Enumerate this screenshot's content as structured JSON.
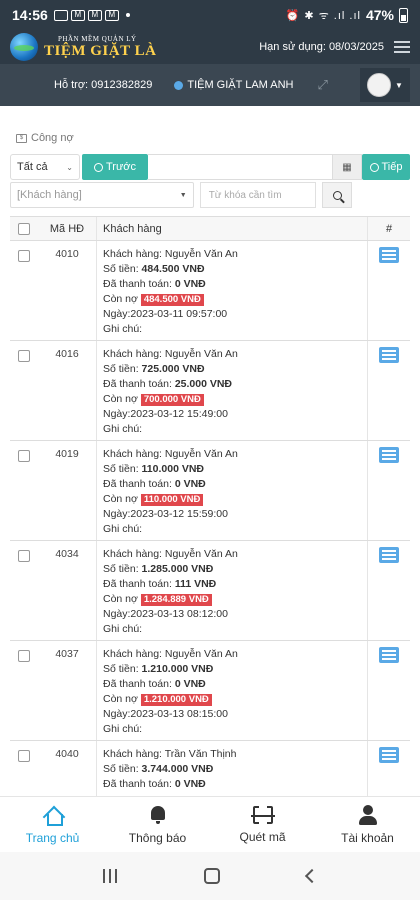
{
  "status_bar": {
    "time": "14:56",
    "battery": "47%"
  },
  "header": {
    "logo_small": "PHẦN MỀM QUẢN LÝ",
    "logo_big": "TIỆM GIẶT LÀ",
    "expiry": "Hạn sử dụng: 08/03/2025"
  },
  "support_bar": {
    "support": "Hỗ trợ: 0912382829",
    "shop_name": "TIỆM GIẶT LAM ANH"
  },
  "section": {
    "title": "Công nợ"
  },
  "filters": {
    "status_value": "Tất cả",
    "prev_label": "Trước",
    "next_label": "Tiếp",
    "customer_placeholder": "[Khách hàng]",
    "keyword_placeholder": "Từ khóa cần tìm"
  },
  "table": {
    "col_id": "Mã HĐ",
    "col_customer": "Khách hàng",
    "col_action": "#",
    "rows": [
      {
        "id": "4010",
        "customer": "Khách hàng: Nguyễn Văn An",
        "amount_label": "Số tiền:",
        "amount": "484.500 VNĐ",
        "paid_label": "Đã thanh toán:",
        "paid": "0 VNĐ",
        "debt_label": "Còn nợ",
        "debt": "484.500 VNĐ",
        "date": "Ngày:2023-03-11 09:57:00",
        "note": "Ghi chú:"
      },
      {
        "id": "4016",
        "customer": "Khách hàng: Nguyễn Văn An",
        "amount_label": "Số tiền:",
        "amount": "725.000 VNĐ",
        "paid_label": "Đã thanh toán:",
        "paid": "25.000 VNĐ",
        "debt_label": "Còn nợ",
        "debt": "700.000 VNĐ",
        "date": "Ngày:2023-03-12 15:49:00",
        "note": "Ghi chú:"
      },
      {
        "id": "4019",
        "customer": "Khách hàng: Nguyễn Văn An",
        "amount_label": "Số tiền:",
        "amount": "110.000 VNĐ",
        "paid_label": "Đã thanh toán:",
        "paid": "0 VNĐ",
        "debt_label": "Còn nợ",
        "debt": "110.000 VNĐ",
        "date": "Ngày:2023-03-12 15:59:00",
        "note": "Ghi chú:"
      },
      {
        "id": "4034",
        "customer": "Khách hàng: Nguyễn Văn An",
        "amount_label": "Số tiền:",
        "amount": "1.285.000 VNĐ",
        "paid_label": "Đã thanh toán:",
        "paid": "111 VNĐ",
        "debt_label": "Còn nợ",
        "debt": "1.284.889 VNĐ",
        "date": "Ngày:2023-03-13 08:12:00",
        "note": "Ghi chú:"
      },
      {
        "id": "4037",
        "customer": "Khách hàng: Nguyễn Văn An",
        "amount_label": "Số tiền:",
        "amount": "1.210.000 VNĐ",
        "paid_label": "Đã thanh toán:",
        "paid": "0 VNĐ",
        "debt_label": "Còn nợ",
        "debt": "1.210.000 VNĐ",
        "date": "Ngày:2023-03-13 08:15:00",
        "note": "Ghi chú:"
      },
      {
        "id": "4040",
        "customer": "Khách hàng: Trần Văn Thịnh",
        "amount_label": "Số tiền:",
        "amount": "3.744.000 VNĐ",
        "paid_label": "Đã thanh toán:",
        "paid": "0 VNĐ",
        "debt_label": "",
        "debt": "",
        "date": "",
        "note": ""
      }
    ]
  },
  "bottom_nav": {
    "items": [
      {
        "label": "Trang chủ",
        "icon": "home-icon"
      },
      {
        "label": "Thông báo",
        "icon": "bell-icon"
      },
      {
        "label": "Quét mã",
        "icon": "scan-icon"
      },
      {
        "label": "Tài khoản",
        "icon": "user-icon"
      }
    ]
  },
  "colors": {
    "header_bg": "#2e3a45",
    "teal_button": "#3ab7a8",
    "debt_badge": "#e0474c",
    "nav_active": "#1fa0d8"
  }
}
